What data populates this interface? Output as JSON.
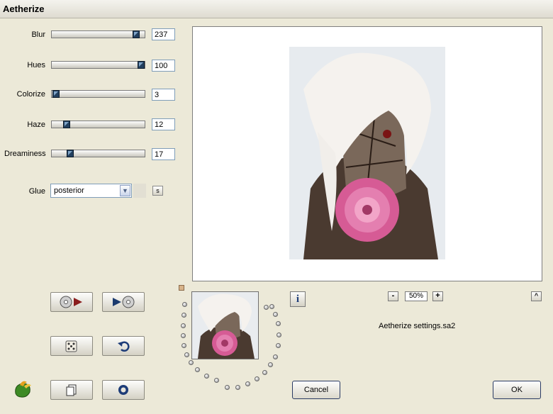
{
  "window": {
    "title": "Aetherize"
  },
  "sliders": [
    {
      "label": "Blur",
      "value": "237",
      "fraction": 0.93
    },
    {
      "label": "Hues",
      "value": "100",
      "fraction": 1.0
    },
    {
      "label": "Colorize",
      "value": "3",
      "fraction": 0.01
    },
    {
      "label": "Haze",
      "value": "12",
      "fraction": 0.12
    },
    {
      "label": "Dreaminess",
      "value": "17",
      "fraction": 0.17
    }
  ],
  "glue": {
    "label": "Glue",
    "value": "posterior",
    "side_button": "s"
  },
  "zoom": {
    "value": "50%",
    "minus": "-",
    "plus": "+"
  },
  "scroll_up": "^",
  "info_label": "i",
  "settings_file": "Aetherize settings.sa2",
  "buttons": {
    "cancel": "Cancel",
    "ok": "OK"
  },
  "colors": {
    "accent": "#23405f",
    "background": "#ece9d8",
    "flower": "#e06aa0"
  }
}
